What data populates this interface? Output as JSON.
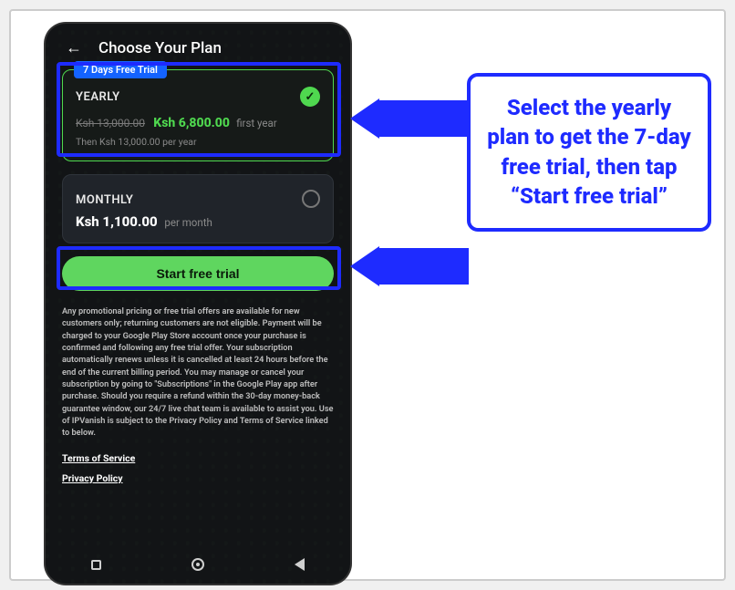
{
  "header": {
    "back_glyph": "←",
    "title": "Choose Your Plan"
  },
  "yearly": {
    "trial_badge": "7 Days Free Trial",
    "name": "YEARLY",
    "original_price": "Ksh 13,000.00",
    "price": "Ksh 6,800.00",
    "price_suffix": "first year",
    "renewal": "Then Ksh 13,000.00 per year",
    "check_glyph": "✓"
  },
  "monthly": {
    "name": "MONTHLY",
    "price": "Ksh 1,100.00",
    "price_suffix": "per month"
  },
  "cta": {
    "label": "Start free trial"
  },
  "legal": {
    "text": "Any promotional pricing or free trial offers are available for new customers only; returning customers are not eligible. Payment will be charged to your Google Play Store account once your purchase is confirmed and following any free trial offer. Your subscription automatically renews unless it is cancelled at least 24 hours before the end of the current billing period. You may manage or cancel your subscription by going to \"Subscriptions\" in the Google Play app after purchase. Should you require a refund within the 30-day money-back guarantee window, our 24/7 live chat team is available to assist you. Use of IPVanish is subject to the Privacy Policy and Terms of Service linked to below."
  },
  "links": {
    "tos": "Terms of Service",
    "privacy": "Privacy Policy"
  },
  "callout": {
    "text": "Select the yearly plan to get the 7-day free trial, then tap “Start free trial”"
  }
}
